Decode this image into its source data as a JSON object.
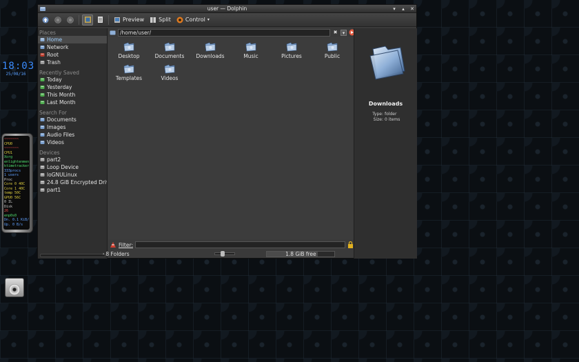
{
  "desktop": {
    "clock": {
      "time": "18:03",
      "date": "25/08/16"
    },
    "sysmon_lines": [
      [
        "c-r",
        "~~~~~~~"
      ],
      [
        "c-y",
        "CPU0"
      ],
      [
        "c-r",
        "~~~~~~~"
      ],
      [
        "c-y",
        "CPU1"
      ],
      [
        "c-g",
        "Xorg"
      ],
      [
        "c-g",
        "enlightenment"
      ],
      [
        "c-g",
        "ktimetracker"
      ],
      [
        "c-b",
        "333procs"
      ],
      [
        "c-b",
        "1 users"
      ],
      [
        "c-w",
        "Proc"
      ],
      [
        "c-y",
        "Core 0    40C"
      ],
      [
        "c-y",
        "Core 1    40C"
      ],
      [
        "c-y",
        "temp      50C"
      ],
      [
        "c-y",
        "GPU0      56C"
      ],
      [
        "c-w",
        "0         IL"
      ],
      [
        "c-w",
        "Disk"
      ],
      [
        "c-r",
        "26"
      ],
      [
        "c-g",
        "enp0s0"
      ],
      [
        "c-b",
        "Dn. 0.1 KiB/s"
      ],
      [
        "c-b",
        "Up. 0 B/s"
      ]
    ]
  },
  "window": {
    "title": "user — Dolphin",
    "controls": {
      "minimize": "▾",
      "maximize": "▴",
      "close": "✕"
    }
  },
  "toolbar": {
    "preview_label": "Preview",
    "split_label": "Split",
    "control_label": "Control"
  },
  "sidebar": {
    "places_title": "Places",
    "places": [
      {
        "label": "Home",
        "icon": "home-icon",
        "selected": true
      },
      {
        "label": "Network",
        "icon": "network-icon"
      },
      {
        "label": "Root",
        "icon": "root-icon"
      },
      {
        "label": "Trash",
        "icon": "trash-icon"
      }
    ],
    "recent_title": "Recently Saved",
    "recent": [
      {
        "label": "Today",
        "icon": "calendar-icon"
      },
      {
        "label": "Yesterday",
        "icon": "calendar-icon"
      },
      {
        "label": "This Month",
        "icon": "calendar-icon"
      },
      {
        "label": "Last Month",
        "icon": "calendar-icon"
      }
    ],
    "search_title": "Search For",
    "search": [
      {
        "label": "Documents",
        "icon": "document-icon"
      },
      {
        "label": "Images",
        "icon": "image-icon"
      },
      {
        "label": "Audio Files",
        "icon": "audio-icon"
      },
      {
        "label": "Videos",
        "icon": "video-icon"
      }
    ],
    "devices_title": "Devices",
    "devices": [
      {
        "label": "part2",
        "icon": "drive-icon"
      },
      {
        "label": "Loop Device",
        "icon": "drive-icon"
      },
      {
        "label": "loGNULinux",
        "icon": "drive-icon"
      },
      {
        "label": "24.8 GiB Encrypted Drive",
        "icon": "drive-icon"
      },
      {
        "label": "part1",
        "icon": "drive-icon"
      }
    ]
  },
  "location": {
    "path": "/home/user/"
  },
  "files": [
    {
      "label": "Desktop",
      "icon": "folder-desktop-icon"
    },
    {
      "label": "Documents",
      "icon": "folder-documents-icon"
    },
    {
      "label": "Downloads",
      "icon": "folder-downloads-icon"
    },
    {
      "label": "Music",
      "icon": "folder-music-icon"
    },
    {
      "label": "Pictures",
      "icon": "folder-pictures-icon"
    },
    {
      "label": "Public",
      "icon": "folder-public-icon"
    },
    {
      "label": "Templates",
      "icon": "folder-templates-icon"
    },
    {
      "label": "Videos",
      "icon": "folder-videos-icon"
    }
  ],
  "info": {
    "name": "Downloads",
    "type_key": "Type:",
    "type_value": "folder",
    "size_key": "Size:",
    "size_value": "0 items"
  },
  "filter": {
    "label": "Filter:",
    "value": ""
  },
  "status": {
    "count": "8 Folders",
    "free": "1.8 GiB free",
    "used_fraction": 0.75
  },
  "colors": {
    "accent": "#9fd0ff",
    "folder_blue": "#8fb0d8",
    "window_bg": "#3a3a3a"
  }
}
